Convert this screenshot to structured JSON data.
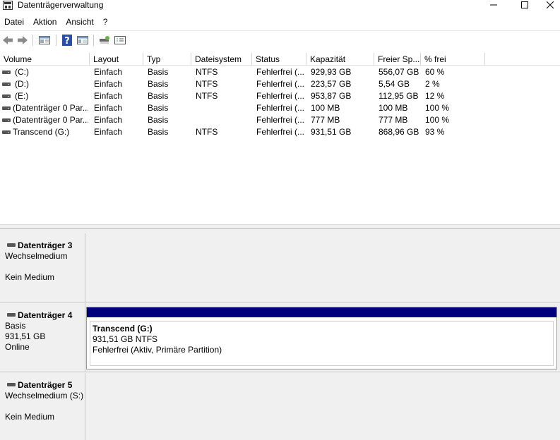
{
  "window": {
    "title": "Datenträgerverwaltung"
  },
  "menu": {
    "items": [
      "Datei",
      "Aktion",
      "Ansicht",
      "?"
    ]
  },
  "toolbar": {
    "icons": [
      "back-arrow-icon",
      "forward-arrow-icon",
      "properties-icon",
      "help-icon",
      "console-view-icon",
      "rescan-icon",
      "settings-icon"
    ]
  },
  "table": {
    "columns": [
      "Volume",
      "Layout",
      "Typ",
      "Dateisystem",
      "Status",
      "Kapazität",
      "Freier Sp...",
      "% frei"
    ],
    "rows": [
      {
        "volume": "(C:)",
        "layout": "Einfach",
        "typ": "Basis",
        "fs": "NTFS",
        "status": "Fehlerfrei (...",
        "kap": "929,93 GB",
        "frei": "556,07 GB",
        "pct": "60 %"
      },
      {
        "volume": "(D:)",
        "layout": "Einfach",
        "typ": "Basis",
        "fs": "NTFS",
        "status": "Fehlerfrei (...",
        "kap": "223,57 GB",
        "frei": "5,54 GB",
        "pct": "2 %"
      },
      {
        "volume": "(E:)",
        "layout": "Einfach",
        "typ": "Basis",
        "fs": "NTFS",
        "status": "Fehlerfrei (...",
        "kap": "953,87 GB",
        "frei": "112,95 GB",
        "pct": "12 %"
      },
      {
        "volume": "(Datenträger 0 Par...",
        "layout": "Einfach",
        "typ": "Basis",
        "fs": "",
        "status": "Fehlerfrei (...",
        "kap": "100 MB",
        "frei": "100 MB",
        "pct": "100 %"
      },
      {
        "volume": "(Datenträger 0 Par...",
        "layout": "Einfach",
        "typ": "Basis",
        "fs": "",
        "status": "Fehlerfrei (...",
        "kap": "777 MB",
        "frei": "777 MB",
        "pct": "100 %"
      },
      {
        "volume": "Transcend (G:)",
        "layout": "Einfach",
        "typ": "Basis",
        "fs": "NTFS",
        "status": "Fehlerfrei (...",
        "kap": "931,51 GB",
        "frei": "868,96 GB",
        "pct": "93 %"
      }
    ]
  },
  "disks": [
    {
      "name": "Datenträger 3",
      "line1": "Wechselmedium",
      "line2": "",
      "line3": "Kein Medium"
    },
    {
      "name": "Datenträger 4",
      "line1": "Basis",
      "line2": "931,51 GB",
      "line3": "Online",
      "partition": {
        "title": "Transcend  (G:)",
        "size": "931,51 GB NTFS",
        "status": "Fehlerfrei (Aktiv, Primäre Partition)",
        "color": "#00007f"
      }
    },
    {
      "name": "Datenträger 5",
      "line1": "Wechselmedium (S:)",
      "line2": "",
      "line3": "Kein Medium"
    }
  ]
}
